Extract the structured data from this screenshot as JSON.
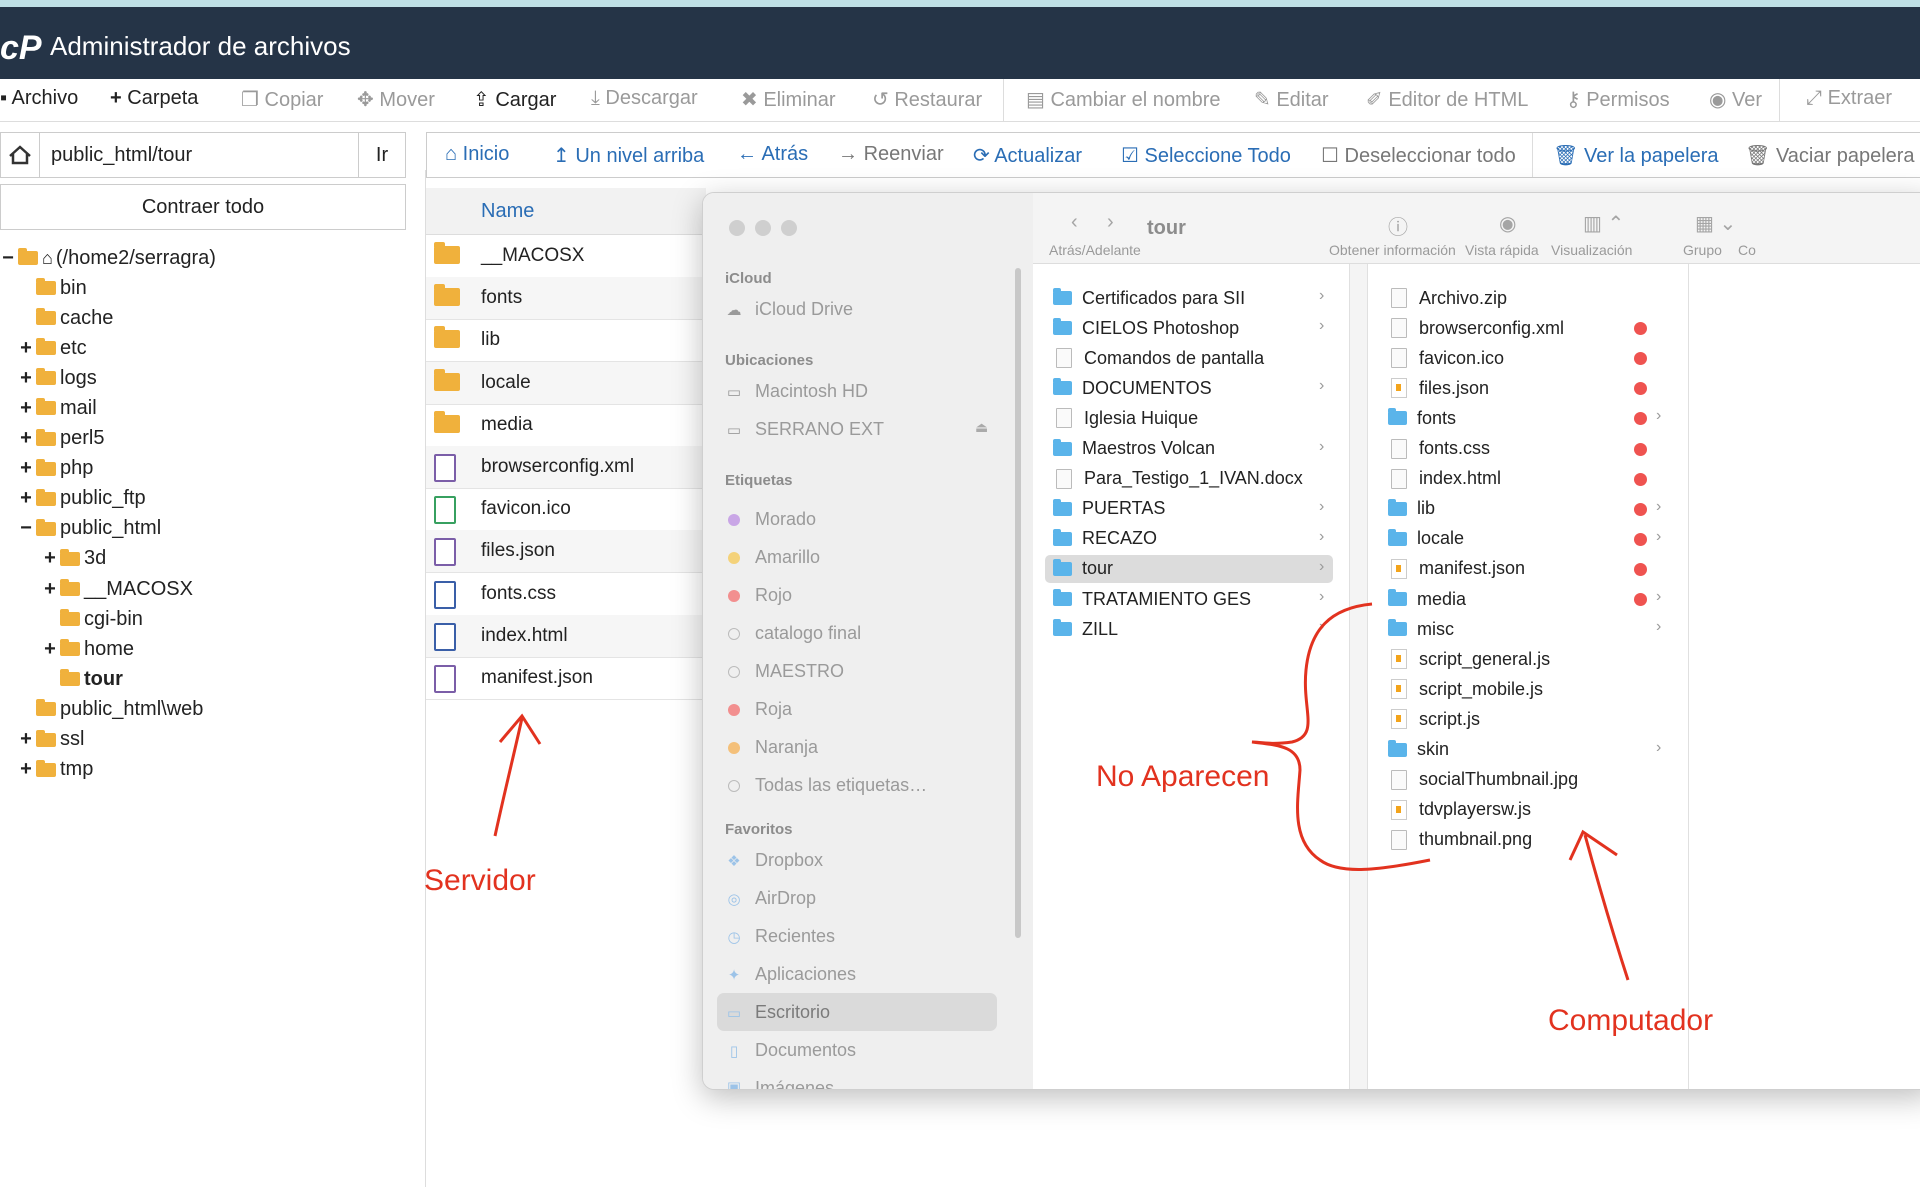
{
  "app": {
    "title": "Administrador de archivos",
    "logo": "cP"
  },
  "toolbar": [
    {
      "label": "Archivo",
      "icon": "plus-icon",
      "enabled": true
    },
    {
      "label": "Carpeta",
      "icon": "plus-icon",
      "enabled": true
    },
    {
      "label": "Copiar",
      "icon": "copy-icon",
      "enabled": false
    },
    {
      "label": "Mover",
      "icon": "move-icon",
      "enabled": false
    },
    {
      "label": "Cargar",
      "icon": "upload-icon",
      "enabled": true
    },
    {
      "label": "Descargar",
      "icon": "download-icon",
      "enabled": false
    },
    {
      "label": "Eliminar",
      "icon": "x-icon",
      "enabled": false
    },
    {
      "label": "Restaurar",
      "icon": "undo-icon",
      "enabled": false
    },
    {
      "label": "Cambiar el nombre",
      "icon": "file-icon",
      "enabled": false
    },
    {
      "label": "Editar",
      "icon": "pencil-icon",
      "enabled": false
    },
    {
      "label": "Editor de HTML",
      "icon": "edit-icon",
      "enabled": false
    },
    {
      "label": "Permisos",
      "icon": "key-icon",
      "enabled": false
    },
    {
      "label": "Ver",
      "icon": "eye-icon",
      "enabled": false
    },
    {
      "label": "Extraer",
      "icon": "expand-icon",
      "enabled": false
    }
  ],
  "path": {
    "value": "public_html/tour",
    "go_label": "Ir"
  },
  "tree": {
    "collapse_label": "Contraer todo",
    "root": "(/home2/serragra)",
    "items": [
      {
        "label": "bin",
        "toggle": ""
      },
      {
        "label": "cache",
        "toggle": ""
      },
      {
        "label": "etc",
        "toggle": "+"
      },
      {
        "label": "logs",
        "toggle": "+"
      },
      {
        "label": "mail",
        "toggle": "+"
      },
      {
        "label": "perl5",
        "toggle": "+"
      },
      {
        "label": "php",
        "toggle": "+"
      },
      {
        "label": "public_ftp",
        "toggle": "+"
      },
      {
        "label": "public_html",
        "toggle": "−"
      },
      {
        "label": "3d",
        "toggle": "+"
      },
      {
        "label": "__MACOSX",
        "toggle": "+"
      },
      {
        "label": "cgi-bin",
        "toggle": ""
      },
      {
        "label": "home",
        "toggle": "+"
      },
      {
        "label": "tour",
        "toggle": ""
      },
      {
        "label": "public_html\\web",
        "toggle": ""
      },
      {
        "label": "ssl",
        "toggle": "+"
      },
      {
        "label": "tmp",
        "toggle": "+"
      }
    ]
  },
  "nav": [
    {
      "label": "Inicio",
      "icon": "home-icon",
      "enabled": true
    },
    {
      "label": "Un nivel arriba",
      "icon": "level-up-icon",
      "enabled": true
    },
    {
      "label": "Atrás",
      "icon": "arrow-left-icon",
      "enabled": true
    },
    {
      "label": "Reenviar",
      "icon": "arrow-right-icon",
      "enabled": false
    },
    {
      "label": "Actualizar",
      "icon": "refresh-icon",
      "enabled": true
    },
    {
      "label": "Seleccione Todo",
      "icon": "checkbox-checked-icon",
      "enabled": true
    },
    {
      "label": "Deseleccionar todo",
      "icon": "checkbox-icon",
      "enabled": false
    },
    {
      "label": "Ver la papelera",
      "icon": "trash-icon",
      "enabled": true
    },
    {
      "label": "Vaciar papelera",
      "icon": "trash-icon",
      "enabled": false
    }
  ],
  "file_list": {
    "header": "Name",
    "rows": [
      {
        "name": "__MACOSX",
        "type": "folder"
      },
      {
        "name": "fonts",
        "type": "folder"
      },
      {
        "name": "lib",
        "type": "folder"
      },
      {
        "name": "locale",
        "type": "folder"
      },
      {
        "name": "media",
        "type": "folder"
      },
      {
        "name": "browserconfig.xml",
        "type": "doc"
      },
      {
        "name": "favicon.ico",
        "type": "image"
      },
      {
        "name": "files.json",
        "type": "doc"
      },
      {
        "name": "fonts.css",
        "type": "code"
      },
      {
        "name": "index.html",
        "type": "code"
      },
      {
        "name": "manifest.json",
        "type": "doc"
      }
    ]
  },
  "finder": {
    "title": "tour",
    "toolbar_labels": {
      "back_forward": "Atrás/Adelante",
      "info": "Obtener información",
      "quicklook": "Vista rápida",
      "view": "Visualización",
      "group": "Grupo",
      "cut": "Co"
    },
    "sidebar": {
      "icloud_head": "iCloud",
      "icloud_drive": "iCloud Drive",
      "locations_head": "Ubicaciones",
      "locations": [
        "Macintosh HD",
        "SERRANO EXT"
      ],
      "tags_head": "Etiquetas",
      "tags": [
        {
          "label": "Morado",
          "color": "#c9a6e6"
        },
        {
          "label": "Amarillo",
          "color": "#f4d27a"
        },
        {
          "label": "Rojo",
          "color": "#f28f8f"
        },
        {
          "label": "catalogo final",
          "color": ""
        },
        {
          "label": "MAESTRO",
          "color": ""
        },
        {
          "label": "Roja",
          "color": "#f28f8f"
        },
        {
          "label": "Naranja",
          "color": "#f4c07a"
        },
        {
          "label": "Todas las etiquetas…",
          "color": ""
        }
      ],
      "favorites_head": "Favoritos",
      "favorites": [
        {
          "label": "Dropbox",
          "icon": "dropbox-icon"
        },
        {
          "label": "AirDrop",
          "icon": "airdrop-icon"
        },
        {
          "label": "Recientes",
          "icon": "clock-icon"
        },
        {
          "label": "Aplicaciones",
          "icon": "apps-icon"
        },
        {
          "label": "Escritorio",
          "icon": "desktop-icon"
        },
        {
          "label": "Documentos",
          "icon": "document-icon"
        },
        {
          "label": "Imágenes",
          "icon": "image-icon"
        }
      ]
    },
    "col1": [
      {
        "name": "Certificados para SII",
        "type": "folder",
        "chevron": true
      },
      {
        "name": "CIELOS Photoshop",
        "type": "folder",
        "chevron": true
      },
      {
        "name": "Comandos de pantalla",
        "type": "doc",
        "chevron": false
      },
      {
        "name": "DOCUMENTOS",
        "type": "folder",
        "chevron": true
      },
      {
        "name": "Iglesia Huique",
        "type": "doc",
        "chevron": false
      },
      {
        "name": "Maestros Volcan",
        "type": "folder",
        "chevron": true
      },
      {
        "name": "Para_Testigo_1_IVAN.docx",
        "type": "doc",
        "chevron": false
      },
      {
        "name": "PUERTAS",
        "type": "folder",
        "chevron": true
      },
      {
        "name": "RECAZO",
        "type": "folder",
        "chevron": true
      },
      {
        "name": "tour",
        "type": "folder",
        "chevron": true,
        "selected": true
      },
      {
        "name": "TRATAMIENTO GES",
        "type": "folder",
        "chevron": true
      },
      {
        "name": "ZILL",
        "type": "folder",
        "chevron": true
      }
    ],
    "col3": [
      {
        "name": "Archivo.zip",
        "type": "doc",
        "tag": false,
        "chevron": false
      },
      {
        "name": "browserconfig.xml",
        "type": "doc",
        "tag": true,
        "chevron": false
      },
      {
        "name": "favicon.ico",
        "type": "doc",
        "tag": true,
        "chevron": false
      },
      {
        "name": "files.json",
        "type": "js",
        "tag": true,
        "chevron": false
      },
      {
        "name": "fonts",
        "type": "folder",
        "tag": true,
        "chevron": true
      },
      {
        "name": "fonts.css",
        "type": "doc",
        "tag": true,
        "chevron": false
      },
      {
        "name": "index.html",
        "type": "doc",
        "tag": true,
        "chevron": false
      },
      {
        "name": "lib",
        "type": "folder",
        "tag": true,
        "chevron": true
      },
      {
        "name": "locale",
        "type": "folder",
        "tag": true,
        "chevron": true
      },
      {
        "name": "manifest.json",
        "type": "js",
        "tag": true,
        "chevron": false
      },
      {
        "name": "media",
        "type": "folder",
        "tag": true,
        "chevron": true
      },
      {
        "name": "misc",
        "type": "folder",
        "tag": false,
        "chevron": true
      },
      {
        "name": "script_general.js",
        "type": "js",
        "tag": false,
        "chevron": false
      },
      {
        "name": "script_mobile.js",
        "type": "js",
        "tag": false,
        "chevron": false
      },
      {
        "name": "script.js",
        "type": "js",
        "tag": false,
        "chevron": false
      },
      {
        "name": "skin",
        "type": "folder",
        "tag": false,
        "chevron": true
      },
      {
        "name": "socialThumbnail.jpg",
        "type": "doc",
        "tag": false,
        "chevron": false
      },
      {
        "name": "tdvplayersw.js",
        "type": "js",
        "tag": false,
        "chevron": false
      },
      {
        "name": "thumbnail.png",
        "type": "doc",
        "tag": false,
        "chevron": false
      }
    ]
  },
  "annotations": {
    "servidor": "Servidor",
    "no_aparecen": "No Aparecen",
    "computador": "Computador"
  },
  "colors": {
    "header": "#253447",
    "link": "#2a6db5",
    "annotation": "#e2321f",
    "tag_red": "#ef5350"
  }
}
